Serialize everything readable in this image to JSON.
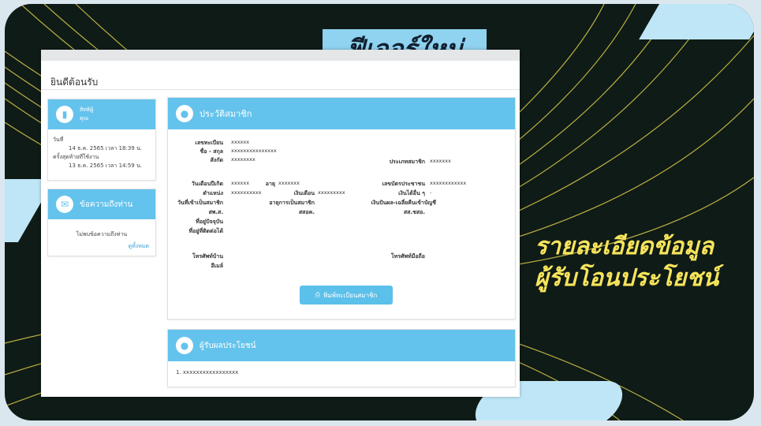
{
  "banner": {
    "title": "ฟีเจอร์ใหม่",
    "caption_line1": "รายละเอียดข้อมูล",
    "caption_line2": "ผู้รับโอนประโยชน์"
  },
  "app": {
    "welcome": "ยินดีต้อนรับ",
    "user_card": {
      "role": "สิทธิผู้",
      "name": "คุณ",
      "date_label": "วันที่",
      "login_time": "14 ธ.ค. 2565 เวลา 18:39 น.",
      "last_used_label": "ครั้งสุดท้ายที่ใช้งาน",
      "last_used_time": "13 ธ.ค. 2565 เวลา 14:59 น."
    },
    "messages_card": {
      "title": "ข้อความถึงท่าน",
      "empty_text": "ไม่พบข้อความถึงท่าน",
      "view_all": "ดูทั้งหมด"
    },
    "profile": {
      "title": "ประวัติสมาชิก",
      "fields": {
        "member_no_label": "เลขทะเบียน",
        "member_no": "xxxxxx",
        "name_label": "ชื่อ - สกุล",
        "name": "xxxxxxxxxxxxxxx",
        "affiliation_label": "สังกัด",
        "affiliation": "xxxxxxxx",
        "member_type_label": "ประเภทสมาชิก",
        "member_type": "xxxxxxx",
        "birth_label": "วันเดือนปีเกิด",
        "birth": "xxxxxx",
        "age_label": "อายุ",
        "age": "xxxxxxx",
        "id_label": "เลขบัตรประชาชน",
        "id": "xxxxxxxxxxxx",
        "position_label": "ตำแหน่ง",
        "position": "xxxxxxxxxx",
        "salary_label": "เงินเดือน",
        "salary": "xxxxxxxxx",
        "other_income_label": "เงินได้อื่น ๆ",
        "other_income": "-",
        "join_date_label": "วันที่เข้าเป็นสมาชิก",
        "membership_age_label": "อายุการเป็นสมาชิก",
        "deposit_label": "เงินปันผล-เฉลี่ยคืนเข้าบัญชี",
        "ps_label": "สพ.ส.",
        "psd_label": "สสอค.",
        "ssc_label": "สส.ชสอ.",
        "current_addr_label": "ที่อยู่ปัจจุบัน",
        "contact_addr_label": "ที่อยู่ที่ติดต่อได้",
        "home_phone_label": "โทรศัพท์บ้าน",
        "mobile_label": "โทรศัพท์มือถือ",
        "email_label": "อีเมล์"
      },
      "print_button": "พิมพ์ทะเบียนสมาชิก"
    },
    "beneficiary": {
      "title": "ผู้รับผลประโยชน์",
      "items": [
        "1.  xxxxxxxxxxxxxxxxx"
      ]
    }
  }
}
